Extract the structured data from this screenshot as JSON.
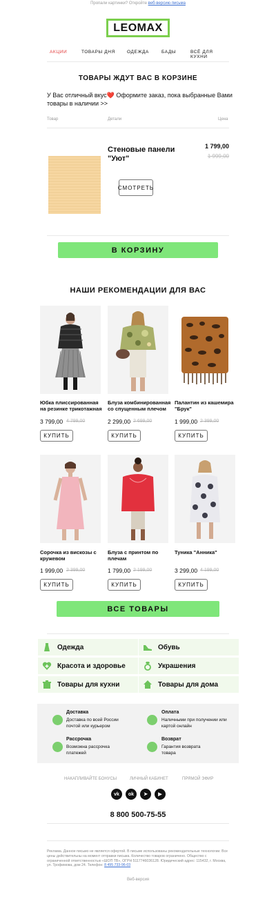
{
  "preheader": {
    "text": "Пропали картинки? Откройте ",
    "link": "веб-версию письма"
  },
  "brand": {
    "logo": "LEOMAX",
    "accent": "#7ccf4e",
    "sale_color": "#e23c3c"
  },
  "nav": [
    "АКЦИИ",
    "ТОВАРЫ ДНЯ",
    "ОДЕЖДА",
    "БАДЫ",
    "ВСЁ ДЛЯ КУХНИ"
  ],
  "cart": {
    "title": "ТОВАРЫ ЖДУТ ВАС В КОРЗИНЕ",
    "message": "У Вас отличный вкус❤️ Оформите заказ, пока выбранные Вами товары в наличии >>",
    "col_item": "Товар",
    "col_details": "Детали",
    "col_price": "Цена",
    "item_name": "Стеновые панели \"Уют\"",
    "price": "1 799,00",
    "old_price": "1 999,00",
    "view_button": "СМОТРЕТЬ",
    "to_cart_button": "В КОРЗИНУ"
  },
  "recs": {
    "title": "НАШИ РЕКОМЕНДАЦИИ ДЛЯ ВАС",
    "buy_label": "КУПИТЬ",
    "items": [
      {
        "name": "Юбка плиссированная на резинке трикотажная",
        "price": "3 799,00",
        "old": "4 799,00"
      },
      {
        "name": "Блуза комбинированная со спущенным плечом",
        "price": "2 299,00",
        "old": "2 699,00"
      },
      {
        "name": "Палантин из кашемира \"Брук\"",
        "price": "1 999,00",
        "old": "2 399,00"
      },
      {
        "name": "Сорочка из вискозы с кружевом",
        "price": "1 999,00",
        "old": "2 399,00"
      },
      {
        "name": "Блуза с принтом по плечам",
        "price": "1 799,00",
        "old": "2 199,00"
      },
      {
        "name": "Туника \"Анника\"",
        "price": "3 299,00",
        "old": "4 199,00"
      }
    ],
    "all_button": "ВСЕ ТОВАРЫ"
  },
  "categories": [
    {
      "label": "Одежда",
      "icon": "dress-icon"
    },
    {
      "label": "Обувь",
      "icon": "shoe-icon"
    },
    {
      "label": "Красота и здоровье",
      "icon": "heart-plus-icon"
    },
    {
      "label": "Украшения",
      "icon": "ring-icon"
    },
    {
      "label": "Товары для кухни",
      "icon": "pot-icon"
    },
    {
      "label": "Товары для дома",
      "icon": "house-icon"
    }
  ],
  "info": [
    {
      "title": "Доставка",
      "text": "Доставка по всей России почтой или курьером",
      "icon": "box-icon"
    },
    {
      "title": "Оплата",
      "text": "Наличными при получении или картой онлайн",
      "icon": "ruble-icon"
    },
    {
      "title": "Рассрочка",
      "text": "Возможна рассрочка платежей",
      "icon": "clock-icon"
    },
    {
      "title": "Возврат",
      "text": "Гарантия возврата товара",
      "icon": "return-icon"
    }
  ],
  "footer_links": [
    "НАКАПЛИВАЙТЕ БОНУСЫ",
    "ЛИЧНЫЙ КАБИНЕТ",
    "ПРЯМОЙ ЭФИР"
  ],
  "socials": [
    "vk",
    "ok",
    "telegram",
    "youtube"
  ],
  "phone": "8 800 500-75-55",
  "legal": {
    "text": "Реклама. Данное письмо не является офертой. В письме использованы рекомендательные технологии. Все цены действительны на момент отправки письма. Количество товаров ограничено. Общество с ограниченной ответственностью «ШОП ТВ», ОГРН 5117746036128. Юридический адрес: 115432, г. Москва, ул. Трофимова, дом 24. Телефон: ",
    "phone_link": "8 495 733-96-03"
  },
  "web_version": "Веб-версия"
}
